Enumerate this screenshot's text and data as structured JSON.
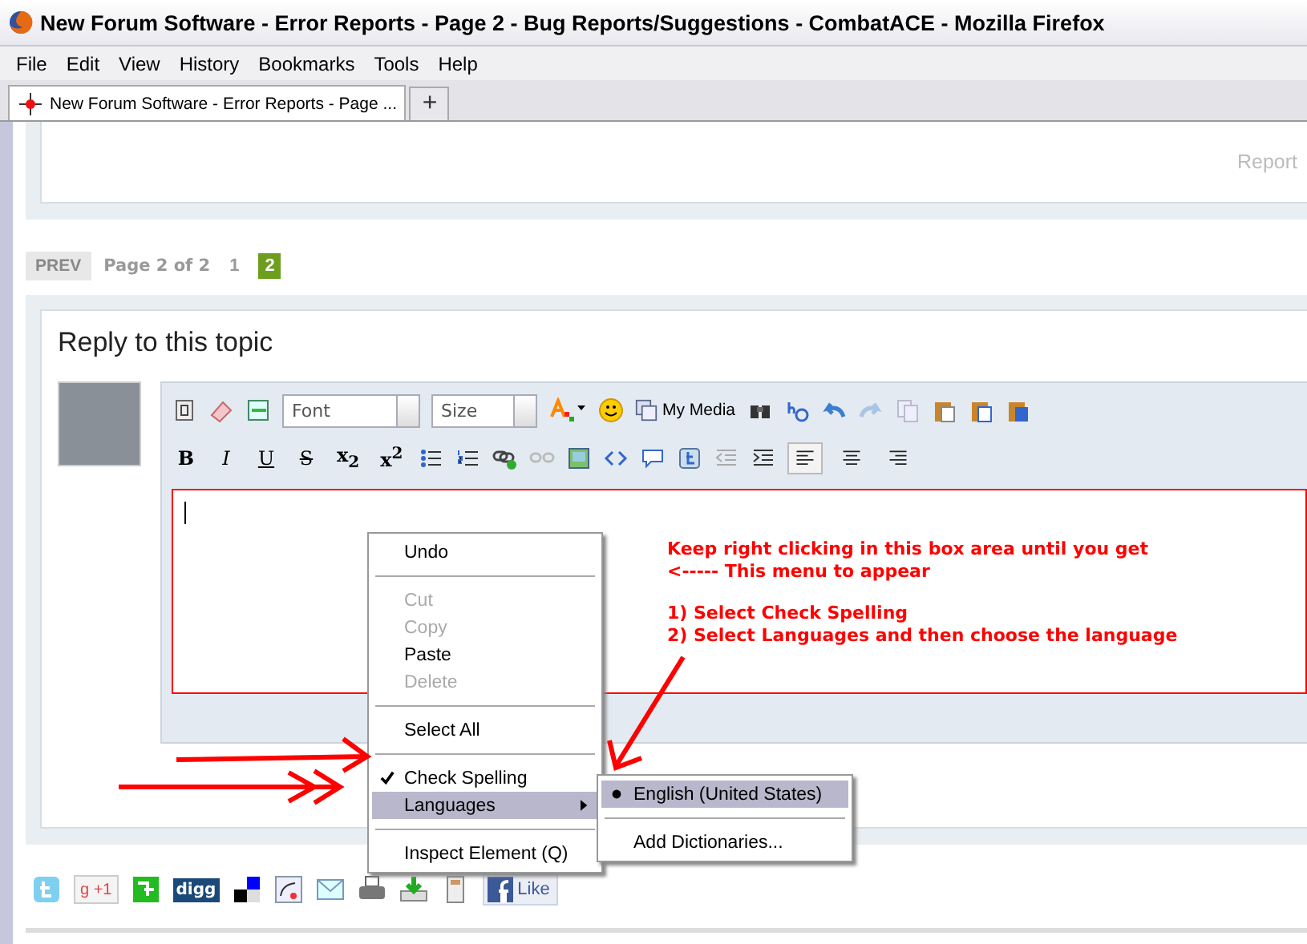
{
  "window": {
    "title": "New Forum Software - Error Reports - Page 2 - Bug Reports/Suggestions - CombatACE - Mozilla Firefox"
  },
  "menu_bar": [
    "File",
    "Edit",
    "View",
    "History",
    "Bookmarks",
    "Tools",
    "Help"
  ],
  "tabs": [
    {
      "label": "New Forum Software - Error Reports - Page ...",
      "selected": true
    }
  ],
  "new_tab_button": "+",
  "post": {
    "report_link": "Report"
  },
  "pagination": {
    "prev": "PREV",
    "summary": "Page 2 of 2",
    "pages": [
      {
        "label": "1",
        "selected": false
      },
      {
        "label": "2",
        "selected": true
      }
    ]
  },
  "reply": {
    "heading": "Reply to this topic",
    "editor": {
      "font_placeholder": "Font",
      "size_placeholder": "Size",
      "media_button": "My Media",
      "format_buttons": [
        {
          "kind": "bold",
          "label": "B"
        },
        {
          "kind": "italic",
          "label": "I"
        },
        {
          "kind": "underline",
          "label": "U"
        },
        {
          "kind": "strike",
          "label": "S"
        },
        {
          "kind": "script",
          "label": "x$_{2}$"
        },
        {
          "kind": "script",
          "label": "x$^{2}$"
        }
      ],
      "alignment": [
        {
          "selected": true
        },
        {
          "selected": false
        },
        {
          "selected": false
        }
      ]
    }
  },
  "annotation": {
    "intro": [
      "Keep right clicking in this box area until you get",
      "<----- This menu to appear"
    ],
    "steps": [
      "1) Select Check Spelling",
      "2) Select Languages and then choose the language"
    ]
  },
  "context_menu": [
    {
      "kind": "item",
      "label": "Undo",
      "disabled": false,
      "checked": false,
      "submenu": false,
      "highlighted": false
    },
    {
      "kind": "separator"
    },
    {
      "kind": "item",
      "label": "Cut",
      "disabled": true,
      "checked": false,
      "submenu": false,
      "highlighted": false
    },
    {
      "kind": "item",
      "label": "Copy",
      "disabled": true,
      "checked": false,
      "submenu": false,
      "highlighted": false
    },
    {
      "kind": "item",
      "label": "Paste",
      "disabled": false,
      "checked": false,
      "submenu": false,
      "highlighted": false
    },
    {
      "kind": "item",
      "label": "Delete",
      "disabled": true,
      "checked": false,
      "submenu": false,
      "highlighted": false
    },
    {
      "kind": "separator"
    },
    {
      "kind": "item",
      "label": "Select All",
      "disabled": false,
      "checked": false,
      "submenu": false,
      "highlighted": false
    },
    {
      "kind": "separator"
    },
    {
      "kind": "item",
      "label": "Check Spelling",
      "disabled": false,
      "checked": true,
      "submenu": false,
      "highlighted": false
    },
    {
      "kind": "item",
      "label": "Languages",
      "disabled": false,
      "checked": false,
      "submenu": true,
      "highlighted": true
    },
    {
      "kind": "separator"
    },
    {
      "kind": "item",
      "label": "Inspect Element (Q)",
      "disabled": false,
      "checked": false,
      "submenu": false,
      "highlighted": false
    }
  ],
  "language_menu": [
    {
      "kind": "item",
      "label": "English (United States)",
      "selected": true,
      "highlighted": true
    },
    {
      "kind": "separator"
    },
    {
      "kind": "item",
      "label": "Add Dictionaries...",
      "selected": false,
      "highlighted": false
    }
  ],
  "share": {
    "google_plus": "g +1",
    "digg": "digg",
    "like": "Like"
  }
}
